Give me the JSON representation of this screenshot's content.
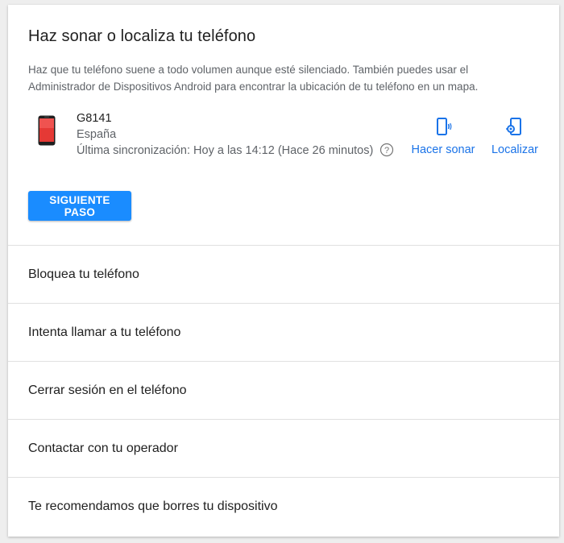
{
  "section": {
    "title": "Haz sonar o localiza tu teléfono",
    "description": "Haz que tu teléfono suene a todo volumen aunque esté silenciado. También puedes usar el Administrador de Dispositivos Android para encontrar la ubicación de tu teléfono en un mapa."
  },
  "device": {
    "name": "G8141",
    "country": "España",
    "last_sync": "Última sincronización: Hoy a las 14:12 (Hace 26 minutos)"
  },
  "actions": {
    "ring_label": "Hacer sonar",
    "locate_label": "Localizar"
  },
  "next_button_label": "SIGUIENTE PASO",
  "options": [
    "Bloquea tu teléfono",
    "Intenta llamar a tu teléfono",
    "Cerrar sesión en el teléfono",
    "Contactar con tu operador",
    "Te recomendamos que borres tu dispositivo"
  ],
  "colors": {
    "accent": "#1a73e8",
    "button": "#1a8cff",
    "divider": "#e0e0e0"
  }
}
